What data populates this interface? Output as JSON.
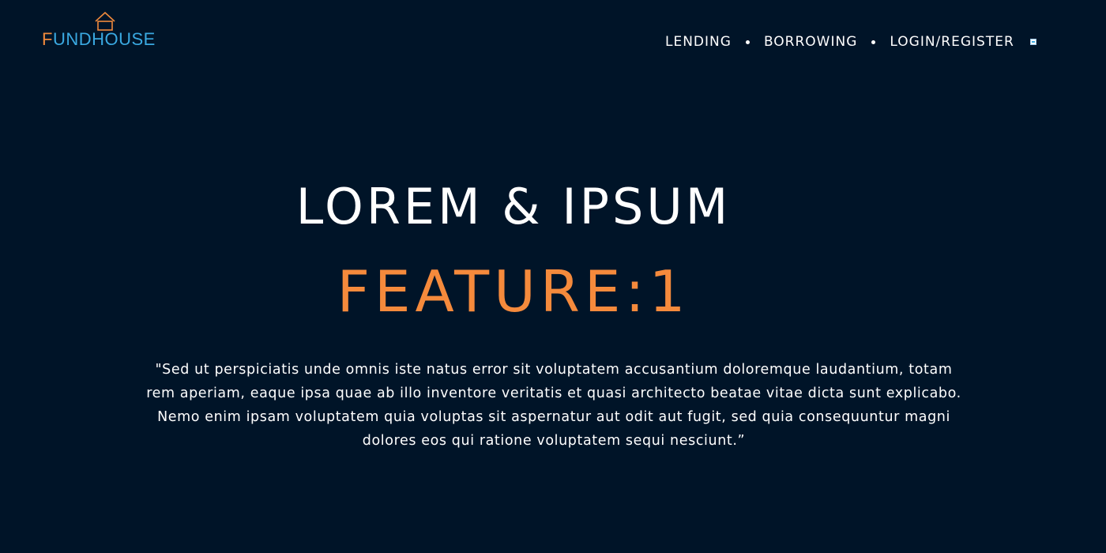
{
  "header": {
    "logo": {
      "first_letter": "F",
      "rest": "UNDHOUSE",
      "colors": {
        "first_letter": "#f08a3c",
        "rest": "#3aa9e1",
        "house_icon": "#f08a3c"
      }
    },
    "nav": {
      "items": [
        {
          "label": "LENDING"
        },
        {
          "label": "BORROWING"
        },
        {
          "label": "LOGIN/REGISTER"
        }
      ],
      "menu_icon": "menu-toggle-icon"
    }
  },
  "hero": {
    "title": "LOREM & IPSUM",
    "feature": "FEATURE:1",
    "quote": "\"Sed ut perspiciatis unde omnis iste natus error sit voluptatem accusantium doloremque laudantium, totam rem aperiam, eaque ipsa quae ab illo inventore veritatis et quasi architecto beatae vitae dicta sunt explicabo. Nemo enim ipsam voluptatem quia voluptas sit aspernatur aut odit aut fugit, sed quia consequuntur magni dolores eos qui ratione voluptatem sequi nesciunt.”"
  },
  "theme": {
    "background": "#001428",
    "accent": "#f58a3c",
    "text": "#ffffff"
  }
}
